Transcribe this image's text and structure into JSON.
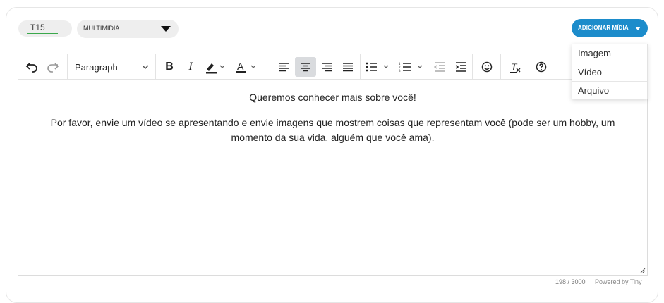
{
  "header": {
    "code_label": "T15",
    "type_label": "MULTIMÍDIA",
    "add_media_label": "ADICIONAR MÍDIA",
    "accent_color": "#1c8ccb"
  },
  "dropdown": {
    "options": [
      "Imagem",
      "Vídeo",
      "Arquivo"
    ]
  },
  "toolbar": {
    "format_label": "Paragraph",
    "icons": [
      "undo-icon",
      "redo-icon",
      "bold-icon",
      "italic-icon",
      "highlight-icon",
      "text-color-icon",
      "align-left-icon",
      "align-center-icon",
      "align-right-icon",
      "align-justify-icon",
      "bullet-list-icon",
      "numbered-list-icon",
      "outdent-icon",
      "indent-icon",
      "emoji-icon",
      "clear-format-icon",
      "help-icon"
    ],
    "active": "align-center"
  },
  "content": {
    "paragraph1": "Queremos conhecer mais sobre você!",
    "paragraph2": "Por favor, envie um vídeo se apresentando e envie imagens que mostrem coisas que representam você (pode ser um hobby, um momento da sua vida, alguém que você ama)."
  },
  "status": {
    "char_count": "198 / 3000",
    "powered_by": "Powered by Tiny"
  }
}
